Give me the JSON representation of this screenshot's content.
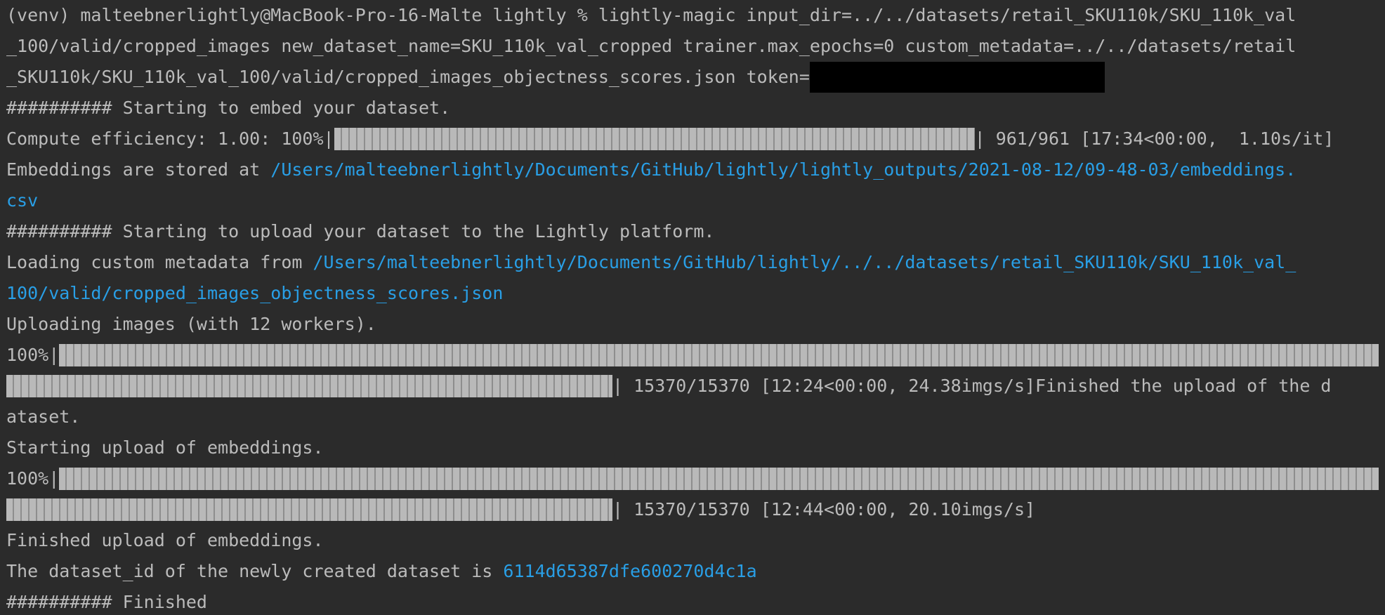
{
  "colors": {
    "background": "#2b2b2b",
    "text": "#bbbbbb",
    "link": "#299fe6",
    "bar": "#b9b9b9",
    "redacted": "#000000"
  },
  "lines": {
    "cmd_1": "(venv) malteebnerlightly@MacBook-Pro-16-Malte lightly % lightly-magic input_dir=../../datasets/retail_SKU110k/SKU_110k_val",
    "cmd_2": "_100/valid/cropped_images new_dataset_name=SKU_110k_val_cropped trainer.max_epochs=0 custom_metadata=../../datasets/retail",
    "cmd_3": "_SKU110k/SKU_110k_val_100/valid/cropped_images_objectness_scores.json token=",
    "embed_start": "########## Starting to embed your dataset.",
    "compute_prefix": "Compute efficiency: 1.00: 100%|",
    "compute_suffix": "| 961/961 [17:34<00:00,  1.10s/it]",
    "embed_stored_prefix": "Embeddings are stored at ",
    "embed_stored_path_1": "/Users/malteebnerlightly/Documents/GitHub/lightly/lightly_outputs/2021-08-12/09-48-03/embeddings.",
    "embed_stored_path_2": "csv",
    "upload_start": "########## Starting to upload your dataset to the Lightly platform.",
    "metadata_prefix": "Loading custom metadata from ",
    "metadata_path_1": "/Users/malteebnerlightly/Documents/GitHub/lightly/../../datasets/retail_SKU110k/SKU_110k_val_",
    "metadata_path_2": "100/valid/cropped_images_objectness_scores.json",
    "uploading_images": "Uploading images (with 12 workers).",
    "upload_pct": "100%|",
    "upload_suffix": "| 15370/15370 [12:24<00:00, 24.38imgs/s]Finished the upload of the d",
    "upload_suffix_2": "ataset.",
    "embed_upload_start": "Starting upload of embeddings.",
    "embed_pct": "100%|",
    "embed_suffix": "| 15370/15370 [12:44<00:00, 20.10imgs/s]",
    "embed_finished": "Finished upload of embeddings.",
    "dataset_id_prefix": "The dataset_id of the newly created dataset is ",
    "dataset_id": "6114d65387dfe600270d4c1a",
    "finished": "########## Finished"
  },
  "progress": {
    "compute_efficiency": 1.0,
    "images_upload_fraction": 1.0,
    "embeddings_upload_fraction": 1.0
  }
}
